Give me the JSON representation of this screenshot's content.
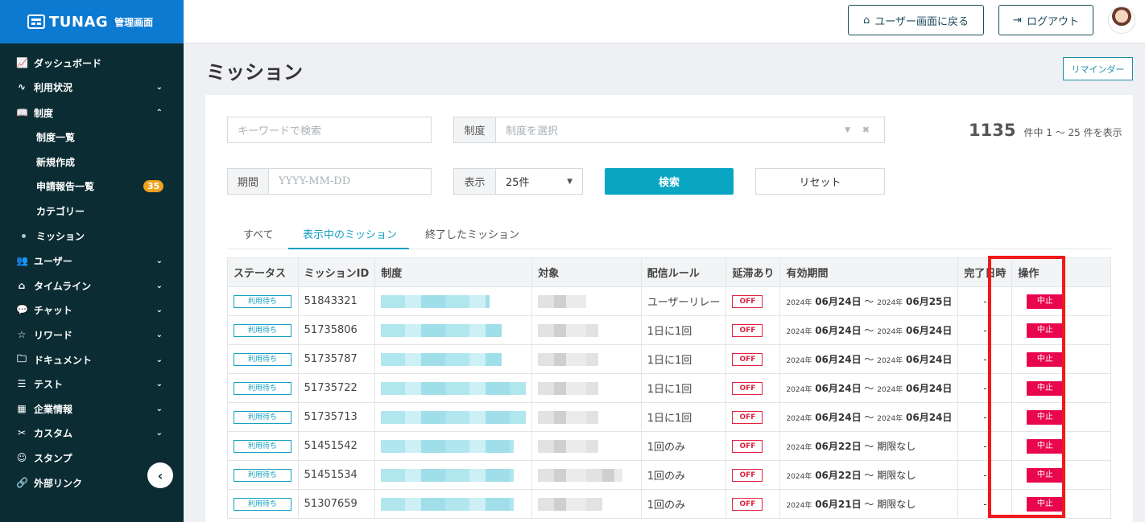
{
  "brand": {
    "name": "TUNAG",
    "sub": "管理画面"
  },
  "sidebar": {
    "items": [
      {
        "icon": "📈",
        "label": "ダッシュボード",
        "chevron": ""
      },
      {
        "icon": "∿",
        "label": "利用状況",
        "chevron": "⌄"
      },
      {
        "icon": "📖",
        "label": "制度",
        "chevron": "⌃"
      },
      {
        "icon": "",
        "label": "制度一覧",
        "chevron": ""
      },
      {
        "icon": "",
        "label": "新規作成",
        "chevron": ""
      },
      {
        "icon": "",
        "label": "申請報告一覧",
        "chevron": "",
        "badge": "35"
      },
      {
        "icon": "",
        "label": "カテゴリー",
        "chevron": ""
      },
      {
        "icon": "",
        "label": "ミッション",
        "chevron": ""
      },
      {
        "icon": "👥",
        "label": "ユーザー",
        "chevron": "⌄"
      },
      {
        "icon": "⌂",
        "label": "タイムライン",
        "chevron": "⌄"
      },
      {
        "icon": "💬",
        "label": "チャット",
        "chevron": "⌄"
      },
      {
        "icon": "☆",
        "label": "リワード",
        "chevron": "⌄"
      },
      {
        "icon": "🗀",
        "label": "ドキュメント",
        "chevron": "⌄"
      },
      {
        "icon": "☰",
        "label": "テスト",
        "chevron": "⌄"
      },
      {
        "icon": "▦",
        "label": "企業情報",
        "chevron": "⌄"
      },
      {
        "icon": "✂",
        "label": "カスタム",
        "chevron": "⌄"
      },
      {
        "icon": "☺",
        "label": "スタンプ",
        "chevron": ""
      },
      {
        "icon": "🔗",
        "label": "外部リンク",
        "chevron": ""
      }
    ],
    "collapse_icon": "‹"
  },
  "header": {
    "back_label": "ユーザー画面に戻る",
    "logout_label": "ログアウト"
  },
  "page": {
    "title": "ミッション",
    "reminder_label": "リマインダー"
  },
  "filters": {
    "keyword_placeholder": "キーワードで検索",
    "system_label": "制度",
    "system_placeholder": "制度を選択",
    "period_label": "期間",
    "period_placeholder": "YYYY-MM-DD",
    "display_label": "表示",
    "display_value": "25件",
    "search_label": "検索",
    "reset_label": "リセット"
  },
  "count": {
    "total": "1135",
    "text": "件中 1 〜 25 件を表示"
  },
  "tabs": [
    "すべて",
    "表示中のミッション",
    "終了したミッション"
  ],
  "table": {
    "headers": [
      "ステータス",
      "ミッションID",
      "制度",
      "対象",
      "配信ルール",
      "延滞あり",
      "有効期間",
      "完了日時",
      "操作"
    ],
    "rows": [
      {
        "status": "利用待ち",
        "id": "51843321",
        "rule": "ユーザーリレー",
        "overdue": "OFF",
        "y1": "2024年",
        "d1": "06月24日",
        "sep": "〜",
        "y2": "2024年",
        "d2": "06月25日",
        "done": "-",
        "action": "中止"
      },
      {
        "status": "利用待ち",
        "id": "51735806",
        "rule": "1日に1回",
        "overdue": "OFF",
        "y1": "2024年",
        "d1": "06月24日",
        "sep": "〜",
        "y2": "2024年",
        "d2": "06月24日",
        "done": "-",
        "action": "中止"
      },
      {
        "status": "利用待ち",
        "id": "51735787",
        "rule": "1日に1回",
        "overdue": "OFF",
        "y1": "2024年",
        "d1": "06月24日",
        "sep": "〜",
        "y2": "2024年",
        "d2": "06月24日",
        "done": "-",
        "action": "中止"
      },
      {
        "status": "利用待ち",
        "id": "51735722",
        "rule": "1日に1回",
        "overdue": "OFF",
        "y1": "2024年",
        "d1": "06月24日",
        "sep": "〜",
        "y2": "2024年",
        "d2": "06月24日",
        "done": "-",
        "action": "中止"
      },
      {
        "status": "利用待ち",
        "id": "51735713",
        "rule": "1日に1回",
        "overdue": "OFF",
        "y1": "2024年",
        "d1": "06月24日",
        "sep": "〜",
        "y2": "2024年",
        "d2": "06月24日",
        "done": "-",
        "action": "中止"
      },
      {
        "status": "利用待ち",
        "id": "51451542",
        "rule": "1回のみ",
        "overdue": "OFF",
        "y1": "2024年",
        "d1": "06月22日",
        "sep": "〜",
        "y2": "",
        "d2": "期限なし",
        "done": "-",
        "action": "中止"
      },
      {
        "status": "利用待ち",
        "id": "51451534",
        "rule": "1回のみ",
        "overdue": "OFF",
        "y1": "2024年",
        "d1": "06月22日",
        "sep": "〜",
        "y2": "",
        "d2": "期限なし",
        "done": "-",
        "action": "中止"
      },
      {
        "status": "利用待ち",
        "id": "51307659",
        "rule": "1回のみ",
        "overdue": "OFF",
        "y1": "2024年",
        "d1": "06月21日",
        "sep": "〜",
        "y2": "",
        "d2": "期限なし",
        "done": "-",
        "action": "中止"
      }
    ]
  }
}
